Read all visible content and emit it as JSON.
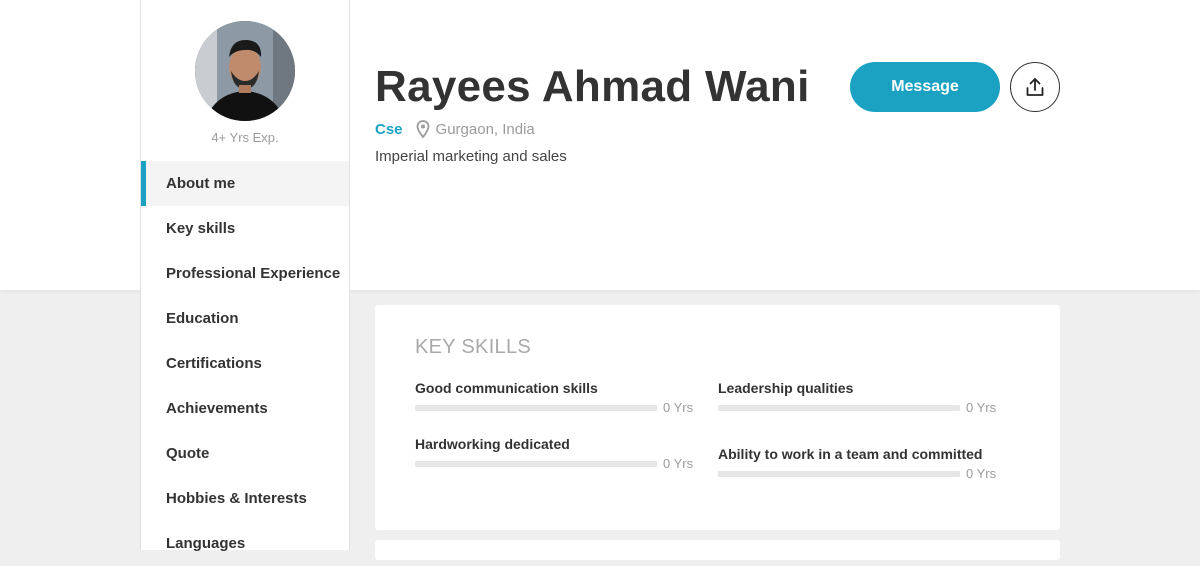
{
  "profile": {
    "name": "Rayees Ahmad Wani",
    "experience": "4+ Yrs Exp.",
    "branch": "Cse",
    "location": "Gurgaon, India",
    "headline": "Imperial marketing and sales",
    "avatar_icon": "profile-photo"
  },
  "actions": {
    "message_label": "Message",
    "share_icon": "share-upload-icon"
  },
  "sidebar": {
    "items": [
      {
        "label": "About me",
        "active": true
      },
      {
        "label": "Key skills"
      },
      {
        "label": "Professional Experience"
      },
      {
        "label": "Education"
      },
      {
        "label": "Certifications"
      },
      {
        "label": "Achievements"
      },
      {
        "label": "Quote"
      },
      {
        "label": "Hobbies & Interests"
      },
      {
        "label": "Languages"
      }
    ]
  },
  "key_skills": {
    "title": "KEY SKILLS",
    "skills": [
      {
        "name": "Good communication skills",
        "years": "0 Yrs",
        "level": 0
      },
      {
        "name": "Leadership qualities",
        "years": "0 Yrs",
        "level": 0
      },
      {
        "name": "Hardworking dedicated",
        "years": "0 Yrs",
        "level": 0
      },
      {
        "name": "Ability to work in a team and committed",
        "years": "0 Yrs",
        "level": 0
      }
    ]
  },
  "colors": {
    "accent": "#1ba2c2",
    "background": "#efefef"
  }
}
